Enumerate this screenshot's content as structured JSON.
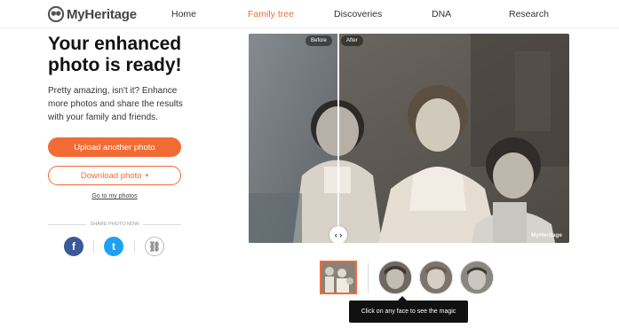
{
  "header": {
    "brand": "MyHeritage",
    "nav": [
      {
        "label": "Home"
      },
      {
        "label": "Family tree",
        "active": true
      },
      {
        "label": "Discoveries"
      },
      {
        "label": "DNA"
      },
      {
        "label": "Research"
      }
    ],
    "accent": "#f26b35"
  },
  "main": {
    "title_line1": "Your enhanced",
    "title_line2": "photo is ready!",
    "description": "Pretty amazing, isn't it? Enhance more photos and share the results with your family and friends.",
    "upload_label": "Upload another photo",
    "download_label": "Download photo",
    "my_photos_link": "Go to my photos",
    "share_label": "SHARE PHOTO NOW"
  },
  "share": {
    "facebook_icon": "f",
    "twitter_icon": "t",
    "link_icon": "⛓"
  },
  "viewer": {
    "before_label": "Before",
    "after_label": "After",
    "handle_glyph": "‹ ›",
    "watermark": "MyHeritage",
    "tooltip": "Click on any face to see the magic"
  }
}
